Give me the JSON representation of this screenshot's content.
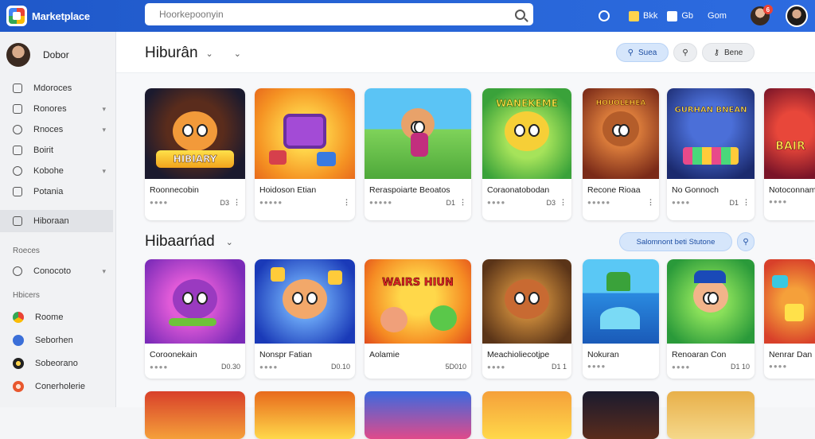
{
  "topbar": {
    "brand": "Marketplace",
    "search_placeholder": "Hoorkepoonyin",
    "actions": [
      {
        "label": "Bkk",
        "icon": "gift-icon"
      },
      {
        "label": "Gb",
        "icon": "bookmark-icon"
      },
      {
        "label": "Gom",
        "icon": "account-icon"
      }
    ],
    "notification_count": "6"
  },
  "sidebar": {
    "profile_name": "Dobor",
    "items": [
      {
        "label": "Mdoroces",
        "icon": "window-icon",
        "chev": false
      },
      {
        "label": "Ronores",
        "icon": "calendar-icon",
        "chev": true
      },
      {
        "label": "Rnoces",
        "icon": "clock-icon",
        "chev": true
      },
      {
        "label": "Boirit",
        "icon": "lock-icon",
        "chev": false
      },
      {
        "label": "Kobohe",
        "icon": "compass-icon",
        "chev": true
      },
      {
        "label": "Potania",
        "icon": "chat-icon",
        "chev": false
      }
    ],
    "active_item": "Hiboraan",
    "section_heading_1": "Roeces",
    "section1_items": [
      {
        "label": "Conocoto",
        "icon": "globe-icon",
        "chev": true
      }
    ],
    "section_heading_2": "Hbicers",
    "section2_items": [
      {
        "label": "Roome",
        "color": "#2f6fe0"
      },
      {
        "label": "Seborhen",
        "color": "#3b6fd8"
      },
      {
        "label": "Sobeorano",
        "color": "#222222"
      },
      {
        "label": "Conerholerie",
        "color": "#e8572e"
      }
    ]
  },
  "main": {
    "header_title": "Hiburân",
    "header_buttons": [
      {
        "label": "Suea",
        "style": "blue"
      },
      {
        "label": "",
        "style": "grey"
      },
      {
        "label": "Bene",
        "style": "grey"
      }
    ],
    "section2_title": "Hibaarńad",
    "section2_button": "Salomnont beti Stutone",
    "row1": [
      {
        "name": "Roonnecobin",
        "stars": "●●●●",
        "meta": "D3"
      },
      {
        "name": "Hoidoson Etian",
        "stars": "●●●●●",
        "meta": ""
      },
      {
        "name": "Reraspoiarte Beoatos",
        "stars": "●●●●●",
        "meta": "D1"
      },
      {
        "name": "Coraonatobodan",
        "stars": "●●●●",
        "meta": "D3"
      },
      {
        "name": "Recone Rioaa",
        "stars": "●●●●●",
        "meta": ""
      },
      {
        "name": "No Gonnoch",
        "stars": "●●●●",
        "meta": "D1"
      },
      {
        "name": "Notoconnam",
        "stars": "●●●●",
        "meta": ""
      }
    ],
    "row2": [
      {
        "name": "Coroonekain",
        "stars": "●●●●",
        "meta": "D0.30"
      },
      {
        "name": "Nonspr Fatian",
        "stars": "●●●●",
        "meta": "D0.10"
      },
      {
        "name": "Aolamie",
        "stars": "",
        "meta": "5D010"
      },
      {
        "name": "Meachioliecotjpe",
        "stars": "●●●●",
        "meta": "D1 1"
      },
      {
        "name": "Nokuran",
        "stars": "●●●●",
        "meta": ""
      },
      {
        "name": "Renoaran Con",
        "stars": "●●●●",
        "meta": "D1 10"
      },
      {
        "name": "Nenrar Dan",
        "stars": "●●●●",
        "meta": ""
      }
    ],
    "art_banners_row1": [
      "HIBIARY",
      "",
      "",
      "WANEKEME",
      "HOUOLEHEA",
      "GURHAN BNEAN",
      "BAIR"
    ],
    "art_banners_row2": [
      "",
      "",
      "WAIRS HIUN",
      "",
      "",
      "",
      ""
    ]
  }
}
